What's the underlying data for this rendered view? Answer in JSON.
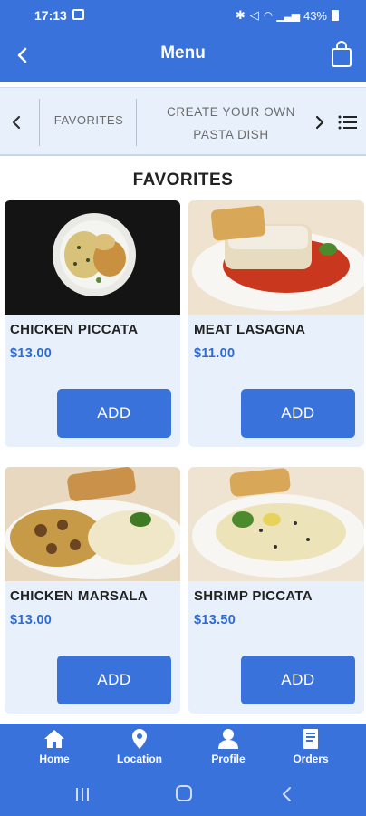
{
  "status_bar": {
    "time": "17:13",
    "battery": "43%"
  },
  "header": {
    "title": "Menu"
  },
  "categories": {
    "items": [
      "FAVORITES",
      "CREATE YOUR OWN",
      "PASTA DISH"
    ]
  },
  "section": {
    "title": "FAVORITES"
  },
  "menu_items": [
    {
      "name": "CHICKEN PICCATA",
      "price": "$13.00",
      "button": "ADD"
    },
    {
      "name": "MEAT LASAGNA",
      "price": "$11.00",
      "button": "ADD"
    },
    {
      "name": "CHICKEN MARSALA",
      "price": "$13.00",
      "button": "ADD"
    },
    {
      "name": "SHRIMP PICCATA",
      "price": "$13.50",
      "button": "ADD"
    }
  ],
  "bottom_nav": [
    {
      "label": "Home",
      "icon": "home-icon"
    },
    {
      "label": "Location",
      "icon": "location-pin-icon"
    },
    {
      "label": "Profile",
      "icon": "person-icon"
    },
    {
      "label": "Orders",
      "icon": "receipt-icon"
    }
  ],
  "colors": {
    "primary": "#3a72dc",
    "card_bg": "#e7f0fb",
    "price": "#2f6bd4"
  }
}
